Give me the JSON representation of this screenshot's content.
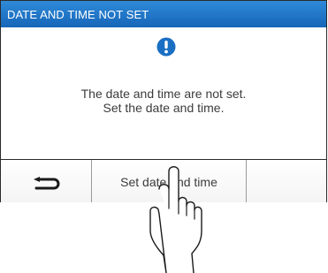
{
  "titlebar": {
    "title": "DATE AND TIME NOT SET"
  },
  "notice": {
    "icon": "exclamation-icon",
    "line1": "The date and time are not set.",
    "line2": "Set the date and time."
  },
  "softkeys": {
    "back_icon": "return-arrow-icon",
    "set_label": "Set date and time"
  },
  "colors": {
    "title_bar": "#1f74c6",
    "icon_blue": "#1a6fc4",
    "text": "#3c3c3c"
  }
}
